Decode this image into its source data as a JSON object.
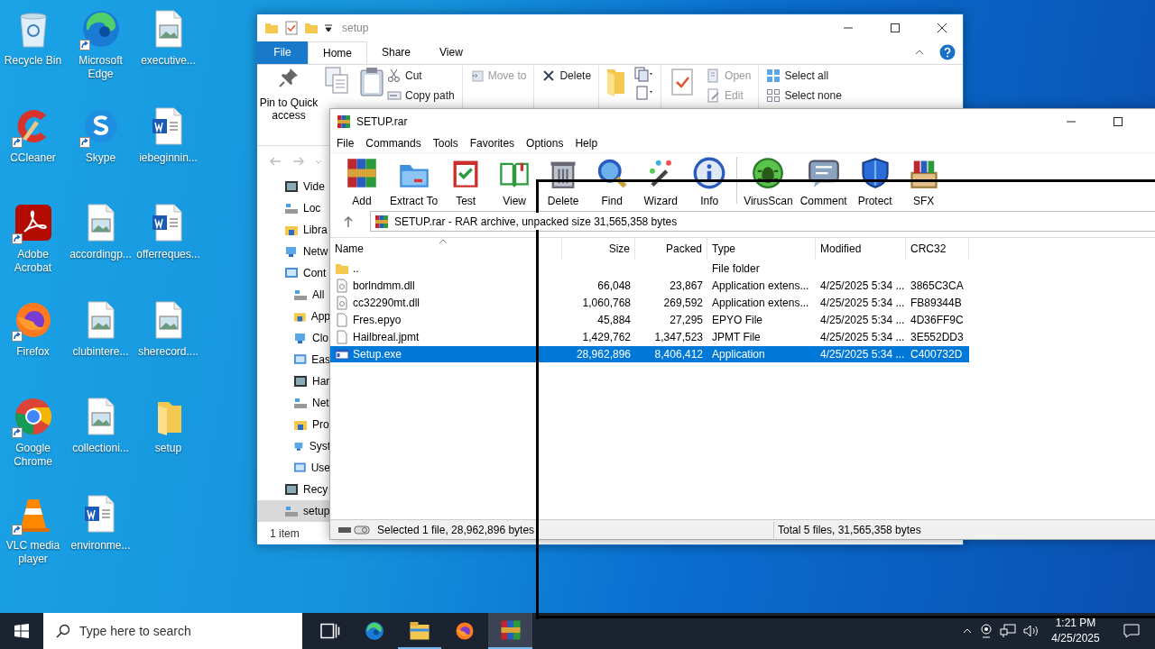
{
  "desktop_icons": [
    {
      "label": "Recycle Bin",
      "kind": "recycle-bin",
      "shortcut": false
    },
    {
      "label": "Microsoft Edge",
      "kind": "edge",
      "shortcut": true
    },
    {
      "label": "executive...",
      "kind": "image-file",
      "shortcut": false
    },
    {
      "label": "CCleaner",
      "kind": "ccleaner",
      "shortcut": true
    },
    {
      "label": "Skype",
      "kind": "skype",
      "shortcut": true
    },
    {
      "label": "iebeginnin...",
      "kind": "word-file",
      "shortcut": false
    },
    {
      "label": "Adobe Acrobat",
      "kind": "acrobat",
      "shortcut": true
    },
    {
      "label": "accordingp...",
      "kind": "image-file",
      "shortcut": false
    },
    {
      "label": "offerreques...",
      "kind": "word-file",
      "shortcut": false
    },
    {
      "label": "Firefox",
      "kind": "firefox",
      "shortcut": true
    },
    {
      "label": "clubintere...",
      "kind": "image-file",
      "shortcut": false
    },
    {
      "label": "sherecord....",
      "kind": "image-file",
      "shortcut": false
    },
    {
      "label": "Google Chrome",
      "kind": "chrome",
      "shortcut": true
    },
    {
      "label": "collectioni...",
      "kind": "image-file",
      "shortcut": false
    },
    {
      "label": "setup",
      "kind": "folder",
      "shortcut": false
    },
    {
      "label": "VLC media player",
      "kind": "vlc",
      "shortcut": true
    },
    {
      "label": "environme...",
      "kind": "word-file",
      "shortcut": false
    }
  ],
  "explorer": {
    "title": "setup",
    "tabs": [
      {
        "label": "File",
        "kind": "file",
        "selected": false
      },
      {
        "label": "Home",
        "kind": "tab",
        "selected": true
      },
      {
        "label": "Share",
        "kind": "tab",
        "selected": false
      },
      {
        "label": "View",
        "kind": "tab",
        "selected": false
      }
    ],
    "ribbon": {
      "pin": "Pin to Quick access",
      "clipboard": [
        {
          "label": "Cut",
          "disabled": false
        },
        {
          "label": "Copy path",
          "disabled": false
        }
      ],
      "organize": [
        {
          "label": "Move to",
          "disabled": true
        },
        {
          "label": "Delete",
          "disabled": false
        }
      ],
      "open": [
        {
          "label": "Open",
          "disabled": true
        },
        {
          "label": "Edit",
          "disabled": true
        }
      ],
      "select": [
        {
          "label": "Select all",
          "disabled": false
        },
        {
          "label": "Select none",
          "disabled": false
        }
      ]
    },
    "nav_pane": [
      {
        "label": "Vide",
        "selected": false
      },
      {
        "label": "Loc",
        "selected": false
      },
      {
        "label": "Libra",
        "selected": false
      },
      {
        "label": "Netw",
        "selected": false
      },
      {
        "label": "Cont",
        "selected": false,
        "children": [
          {
            "label": "All",
            "selected": false
          },
          {
            "label": "App",
            "selected": false
          },
          {
            "label": "Clo",
            "selected": false
          },
          {
            "label": "Eas",
            "selected": false
          },
          {
            "label": "Har",
            "selected": false
          },
          {
            "label": "Net",
            "selected": false
          },
          {
            "label": "Pro",
            "selected": false
          },
          {
            "label": "Syst",
            "selected": false
          },
          {
            "label": "Use",
            "selected": false
          }
        ]
      },
      {
        "label": "Recy",
        "selected": false
      },
      {
        "label": "setup",
        "selected": true
      }
    ],
    "status": "1 item"
  },
  "winrar": {
    "title": "SETUP.rar",
    "menu": [
      "File",
      "Commands",
      "Tools",
      "Favorites",
      "Options",
      "Help"
    ],
    "toolbar": [
      {
        "label": "Add",
        "separator_before": false
      },
      {
        "label": "Extract To",
        "separator_before": false
      },
      {
        "label": "Test",
        "separator_before": false
      },
      {
        "label": "View",
        "separator_before": false
      },
      {
        "label": "Delete",
        "separator_before": false
      },
      {
        "label": "Find",
        "separator_before": false
      },
      {
        "label": "Wizard",
        "separator_before": false
      },
      {
        "label": "Info",
        "separator_before": false
      },
      {
        "label": "VirusScan",
        "separator_before": true
      },
      {
        "label": "Comment",
        "separator_before": false
      },
      {
        "label": "Protect",
        "separator_before": false
      },
      {
        "label": "SFX",
        "separator_before": false
      }
    ],
    "path": "SETUP.rar - RAR archive, unpacked size 31,565,358 bytes",
    "table": {
      "columns": [
        "Name",
        "Size",
        "Packed",
        "Type",
        "Modified",
        "CRC32"
      ],
      "rows": [
        {
          "kind": "folder",
          "selected": false,
          "cells": [
            "..",
            "",
            "",
            "File folder",
            "",
            ""
          ]
        },
        {
          "kind": "library",
          "selected": false,
          "cells": [
            "borlndmm.dll",
            "66,048",
            "23,867",
            "Application extens...",
            "4/25/2025 5:34 ...",
            "3865C3CA"
          ]
        },
        {
          "kind": "library",
          "selected": false,
          "cells": [
            "cc32290mt.dll",
            "1,060,768",
            "269,592",
            "Application extens...",
            "4/25/2025 5:34 ...",
            "FB89344B"
          ]
        },
        {
          "kind": "file",
          "selected": false,
          "cells": [
            "Fres.epyo",
            "45,884",
            "27,295",
            "EPYO File",
            "4/25/2025 5:34 ...",
            "4D36FF9C"
          ]
        },
        {
          "kind": "file",
          "selected": false,
          "cells": [
            "Hailbreal.jpmt",
            "1,429,762",
            "1,347,523",
            "JPMT File",
            "4/25/2025 5:34 ...",
            "3E552DD3"
          ]
        },
        {
          "kind": "application",
          "selected": true,
          "cells": [
            "Setup.exe",
            "28,962,896",
            "8,406,412",
            "Application",
            "4/25/2025 5:34 ...",
            "C400732D"
          ]
        }
      ]
    },
    "status_left": "Selected 1 file, 28,962,896 bytes",
    "status_right": "Total 5 files, 31,565,358 bytes"
  },
  "taskbar": {
    "search": {
      "placeholder": "Type here to search"
    },
    "apps": [
      {
        "kind": "task-view",
        "running": false,
        "selected": false
      },
      {
        "kind": "edge",
        "running": false,
        "selected": false
      },
      {
        "kind": "explorer",
        "running": true,
        "selected": false
      },
      {
        "kind": "firefox",
        "running": false,
        "selected": false
      },
      {
        "kind": "winrar",
        "running": true,
        "selected": true
      }
    ],
    "time": "1:21 PM",
    "date": "4/25/2025"
  }
}
